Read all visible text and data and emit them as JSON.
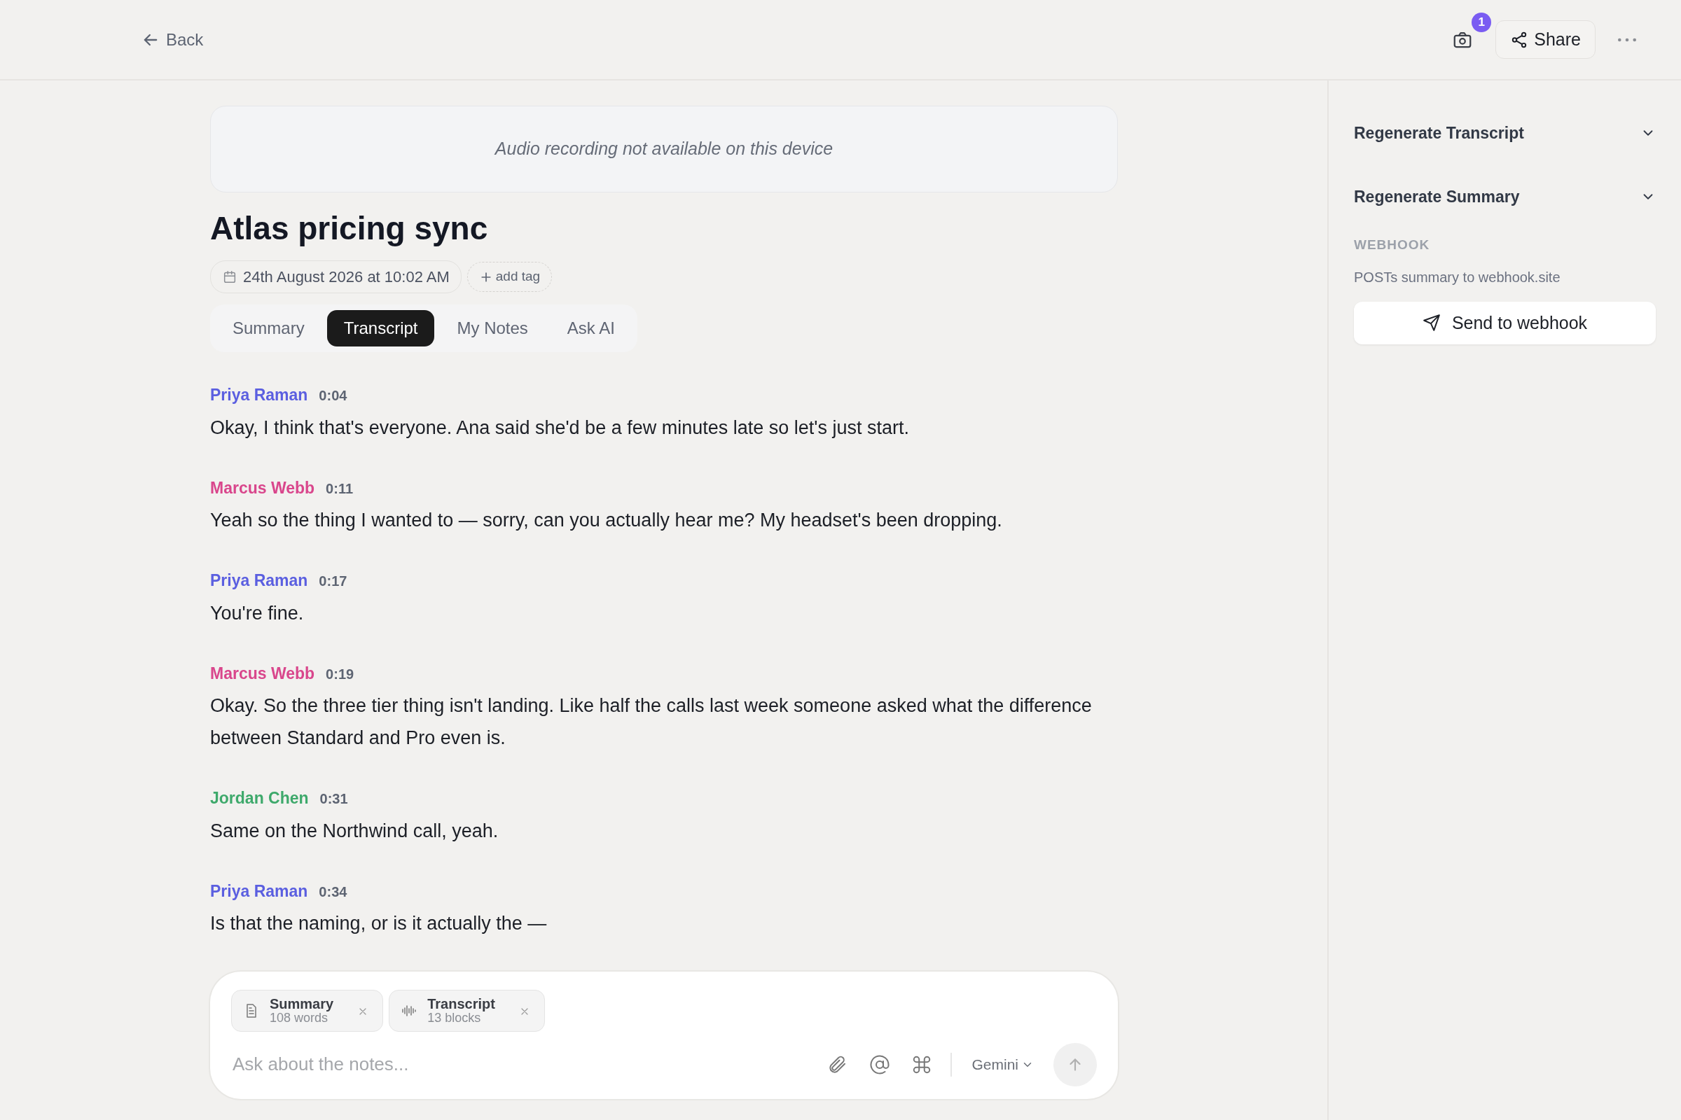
{
  "top_bar": {
    "back": "Back",
    "camera_badge": "1",
    "share": "Share"
  },
  "audio_notice": "Audio recording not available on this device",
  "title": "Atlas pricing sync",
  "date": "24th August 2026 at 10:02 AM",
  "add_tag": "add tag",
  "tabs": [
    {
      "label": "Summary",
      "selected": false
    },
    {
      "label": "Transcript",
      "selected": true
    },
    {
      "label": "My Notes",
      "selected": false
    },
    {
      "label": "Ask AI",
      "selected": false
    }
  ],
  "transcript": [
    {
      "speaker": "Priya Raman",
      "color": "#5b5fe0",
      "time": "0:04",
      "text": "Okay, I think that's everyone. Ana said she'd be a few minutes late so let's just start."
    },
    {
      "speaker": "Marcus Webb",
      "color": "#d9468c",
      "time": "0:11",
      "text": "Yeah so the thing I wanted to — sorry, can you actually hear me? My headset's been dropping."
    },
    {
      "speaker": "Priya Raman",
      "color": "#5b5fe0",
      "time": "0:17",
      "text": "You're fine."
    },
    {
      "speaker": "Marcus Webb",
      "color": "#d9468c",
      "time": "0:19",
      "text": "Okay. So the three tier thing isn't landing. Like half the calls last week someone asked what the difference between Standard and Pro even is."
    },
    {
      "speaker": "Jordan Chen",
      "color": "#3ea96b",
      "time": "0:31",
      "text": "Same on the Northwind call, yeah."
    },
    {
      "speaker": "Priya Raman",
      "color": "#5b5fe0",
      "time": "0:34",
      "text": "Is that the naming, or is it actually the —"
    }
  ],
  "composer": {
    "attachments": [
      {
        "kind": "document",
        "title": "Summary",
        "detail": "108 words"
      },
      {
        "kind": "waveform",
        "title": "Transcript",
        "detail": "13 blocks"
      }
    ],
    "placeholder": "Ask about the notes...",
    "model": "Gemini",
    "send_disabled": true
  },
  "sidebar": {
    "sections": [
      {
        "title": "Regenerate Transcript",
        "expanded": false
      },
      {
        "title": "Regenerate Summary",
        "expanded": false
      }
    ],
    "webhook": {
      "heading": "WEBHOOK",
      "description": "POSTs summary to webhook.site",
      "button": "Send to webhook"
    }
  }
}
